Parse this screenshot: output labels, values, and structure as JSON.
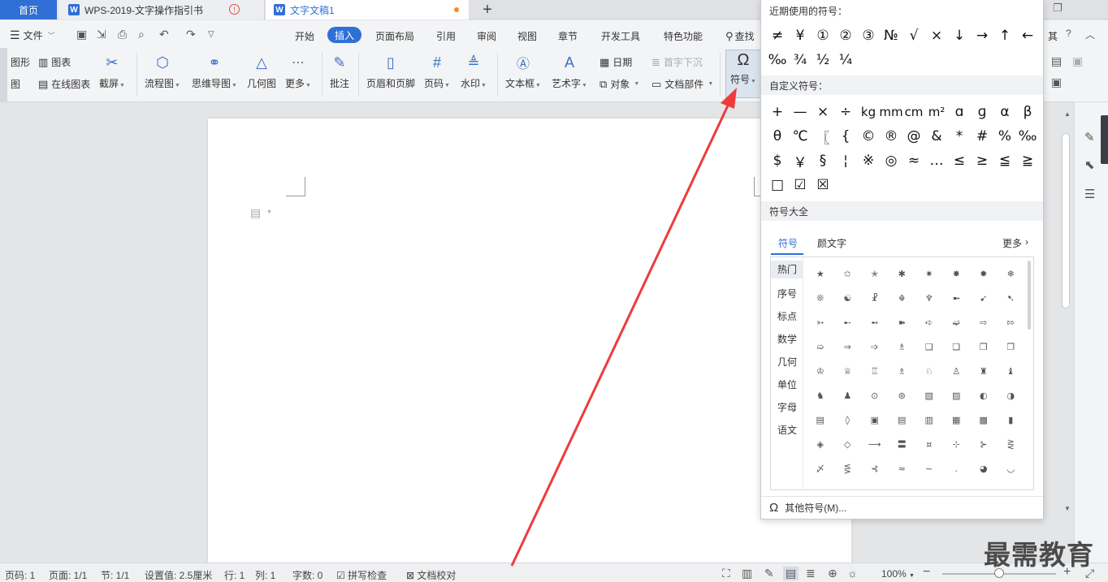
{
  "tabs": {
    "home": "首页",
    "doc1": "WPS-2019-文字操作指引书",
    "doc2": "文字文稿1",
    "new_tab": "+",
    "doc1_alert": "!"
  },
  "menu": {
    "file": "文件",
    "tabs": [
      "开始",
      "插入",
      "页面布局",
      "引用",
      "审阅",
      "视图",
      "章节",
      "开发工具",
      "特色功能"
    ],
    "search": "查找",
    "cut_off_end": "其"
  },
  "ribbon": {
    "shape_partial": "图形",
    "chart": "图表",
    "pic_partial": "图",
    "online_chart": "在线图表",
    "screenshot": "截屏",
    "flowchart": "流程图",
    "mindmap": "思维导图",
    "geometry": "几何图",
    "more": "更多",
    "comment": "批注",
    "header_footer": "页眉和页脚",
    "page_number": "页码",
    "watermark": "水印",
    "textbox": "文本框",
    "wordart": "艺术字",
    "date": "日期",
    "drop_cap": "首字下沉",
    "object": "对象",
    "doc_parts": "文档部件",
    "symbol": "符号"
  },
  "symbol_panel": {
    "recent_title": "近期使用的符号：",
    "recent": [
      "≠",
      "¥",
      "①",
      "②",
      "③",
      "№",
      "√",
      "×",
      "↓",
      "→",
      "↑",
      "←",
      "‰",
      "¾",
      "½",
      "¼"
    ],
    "custom_title": "自定义符号：",
    "custom": [
      "+",
      "—",
      "×",
      "÷",
      "kg",
      "mm",
      "cm",
      "m²",
      "ɑ",
      "ɡ",
      "α",
      "β",
      "θ",
      "℃",
      "〖",
      "{",
      "©",
      "®",
      "@",
      "&",
      "*",
      "#",
      "%",
      "‰",
      "$",
      "￥",
      "§",
      "¦",
      "※",
      "◎",
      "≈",
      "…",
      "≤",
      "≥",
      "≦",
      "≧",
      "□",
      "☑",
      "☒"
    ],
    "all_title": "符号大全",
    "tab_symbols": "符号",
    "tab_kaomoji": "颜文字",
    "more": "更多",
    "categories": [
      "热门",
      "序号",
      "标点",
      "数学",
      "几何",
      "单位",
      "字母",
      "语文"
    ],
    "grid": [
      "★",
      "✩",
      "✭",
      "✱",
      "✷",
      "✸",
      "✹",
      "❄",
      "❊",
      "☯",
      "☧",
      "☬",
      "♆",
      "➼",
      "➹",
      "➷",
      "➳",
      "➸",
      "➻",
      "➽",
      "➪",
      "➫",
      "⇨",
      "⇰",
      "➯",
      "⇒",
      "➩",
      "♗",
      "❏",
      "❑",
      "❒",
      "❐",
      "♔",
      "♕",
      "♖",
      "♗",
      "♘",
      "♙",
      "♜",
      "♝",
      "♞",
      "♟",
      "⊙",
      "⊚",
      "▧",
      "▨",
      "◐",
      "◑",
      "▤",
      "◊",
      "▣",
      "▤",
      "▥",
      "▦",
      "▩",
      "▮",
      "◈",
      "◇",
      "⟶",
      "〓",
      "¤",
      "⊹",
      "⊱",
      "⋛",
      "〆",
      "⋚",
      "⊰",
      "≈",
      "~",
      ".",
      "◕",
      "◡"
    ],
    "other": "其他符号(M)..."
  },
  "status": {
    "page": "页码: 1",
    "pages": "页面: 1/1",
    "section": "节: 1/1",
    "setting": "设置值: 2.5厘米",
    "row": "行: 1",
    "col": "列: 1",
    "words": "字数: 0",
    "spell": "拼写检查",
    "proof": "文档校对",
    "zoom": "100%",
    "zoom_fraction": 0.5
  },
  "watermark": "最需教育",
  "colors": {
    "accent": "#2f6fd6",
    "arrow": "#ee3b3b"
  }
}
